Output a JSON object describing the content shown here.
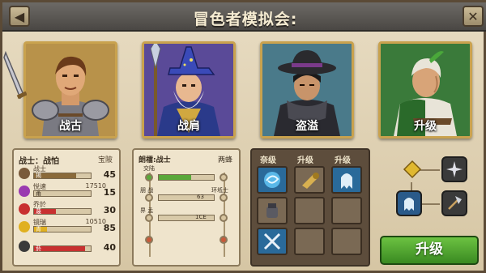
{
  "title": "冒色者模拟会:",
  "nav": {
    "back_glyph": "◀",
    "close_glyph": "✕"
  },
  "heroes": [
    {
      "name": "战古"
    },
    {
      "name": "战肩"
    },
    {
      "name": "盗溢"
    },
    {
      "name": "升级"
    }
  ],
  "stats": {
    "header": "战士：战怕",
    "header_right": "宝陂",
    "rows": [
      {
        "label": "战士",
        "bar_tag": "揭",
        "value": "45",
        "sub": "",
        "fill": 0.72,
        "color": "#8a6a3a",
        "icon": "shield-icon"
      },
      {
        "label": "悦速",
        "bar_tag": "甬",
        "value": "15",
        "sub": "17510",
        "fill": 0.0,
        "color": "#9a3ab0",
        "icon": "speed-icon"
      },
      {
        "label": "乔於",
        "bar_tag": "蔑",
        "value": "30",
        "sub": "",
        "fill": 0.38,
        "color": "#c83030",
        "icon": "fire-icon"
      },
      {
        "label": "镜瑞",
        "bar_tag": "青",
        "value": "85",
        "sub": "10510",
        "fill": 0.22,
        "color": "#e0b020",
        "icon": "coin-icon"
      },
      {
        "label": "",
        "bar_tag": "菸",
        "value": "40",
        "sub": "",
        "fill": 0.88,
        "color": "#c83030",
        "icon": "armor-icon"
      }
    ]
  },
  "skill": {
    "header": "朗檑:战士",
    "header_right": "两蜂",
    "labels": [
      "交陆",
      "朋 战",
      "界 孟",
      "环坻士"
    ],
    "nums": [
      "",
      "63",
      "1CE"
    ]
  },
  "upgrade_panel": {
    "tabs": [
      "奈级",
      "升级",
      "升级"
    ]
  },
  "upgrade_button": "升级"
}
